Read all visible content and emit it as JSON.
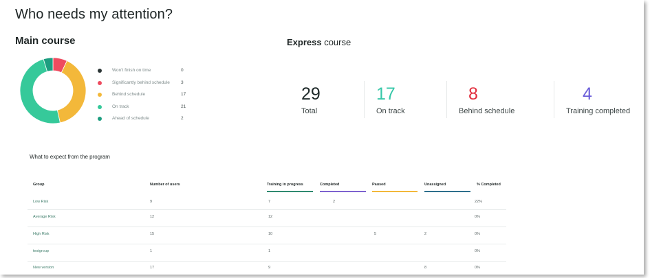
{
  "page_title": "Who needs my attention?",
  "main_course": {
    "title": "Main course",
    "legend": [
      {
        "label": "Won't finish on time",
        "count": "0",
        "color": "#2c3636"
      },
      {
        "label": "Significantly behind schedule",
        "count": "3",
        "color": "#ee4b5f"
      },
      {
        "label": "Behind schedule",
        "count": "17",
        "color": "#f3b83a"
      },
      {
        "label": "On track",
        "count": "21",
        "color": "#36c99a"
      },
      {
        "label": "Ahead of schedule",
        "count": "2",
        "color": "#1d9e80"
      }
    ]
  },
  "express_course": {
    "title_bold": "Express",
    "title_rest": " course",
    "stats": [
      {
        "value": "29",
        "caption": "Total",
        "color": "#1f2a2a"
      },
      {
        "value": "17",
        "caption": "On track",
        "color": "#36c7a8"
      },
      {
        "value": "8",
        "caption": "Behind schedule",
        "color": "#e2303f"
      },
      {
        "value": "4",
        "caption": "Training completed",
        "color": "#6a5dd9"
      }
    ]
  },
  "program": {
    "title": "What to expect from the program",
    "columns": [
      {
        "label": "Group",
        "bar_color": ""
      },
      {
        "label": "Number of users",
        "bar_color": ""
      },
      {
        "label": "Training in progress",
        "bar_color": "#2f8a70"
      },
      {
        "label": "Completed",
        "bar_color": "#7d62cf"
      },
      {
        "label": "Paused",
        "bar_color": "#f3b83a"
      },
      {
        "label": "Unassigned",
        "bar_color": "#2d6f8c"
      },
      {
        "label": "% Completed",
        "bar_color": ""
      }
    ],
    "rows": [
      {
        "group": "Low Risk",
        "users": "9",
        "in_progress": "7",
        "completed": "2",
        "paused": "",
        "unassigned": "",
        "pct": "22%"
      },
      {
        "group": "Average Risk",
        "users": "12",
        "in_progress": "12",
        "completed": "",
        "paused": "",
        "unassigned": "",
        "pct": "0%"
      },
      {
        "group": "High Risk",
        "users": "15",
        "in_progress": "10",
        "completed": "",
        "paused": "5",
        "unassigned": "2",
        "pct": "0%"
      },
      {
        "group": "testgroup",
        "users": "1",
        "in_progress": "1",
        "completed": "",
        "paused": "",
        "unassigned": "",
        "pct": "0%"
      },
      {
        "group": "New version",
        "users": "17",
        "in_progress": "9",
        "completed": "",
        "paused": "",
        "unassigned": "8",
        "pct": "0%"
      }
    ]
  }
}
